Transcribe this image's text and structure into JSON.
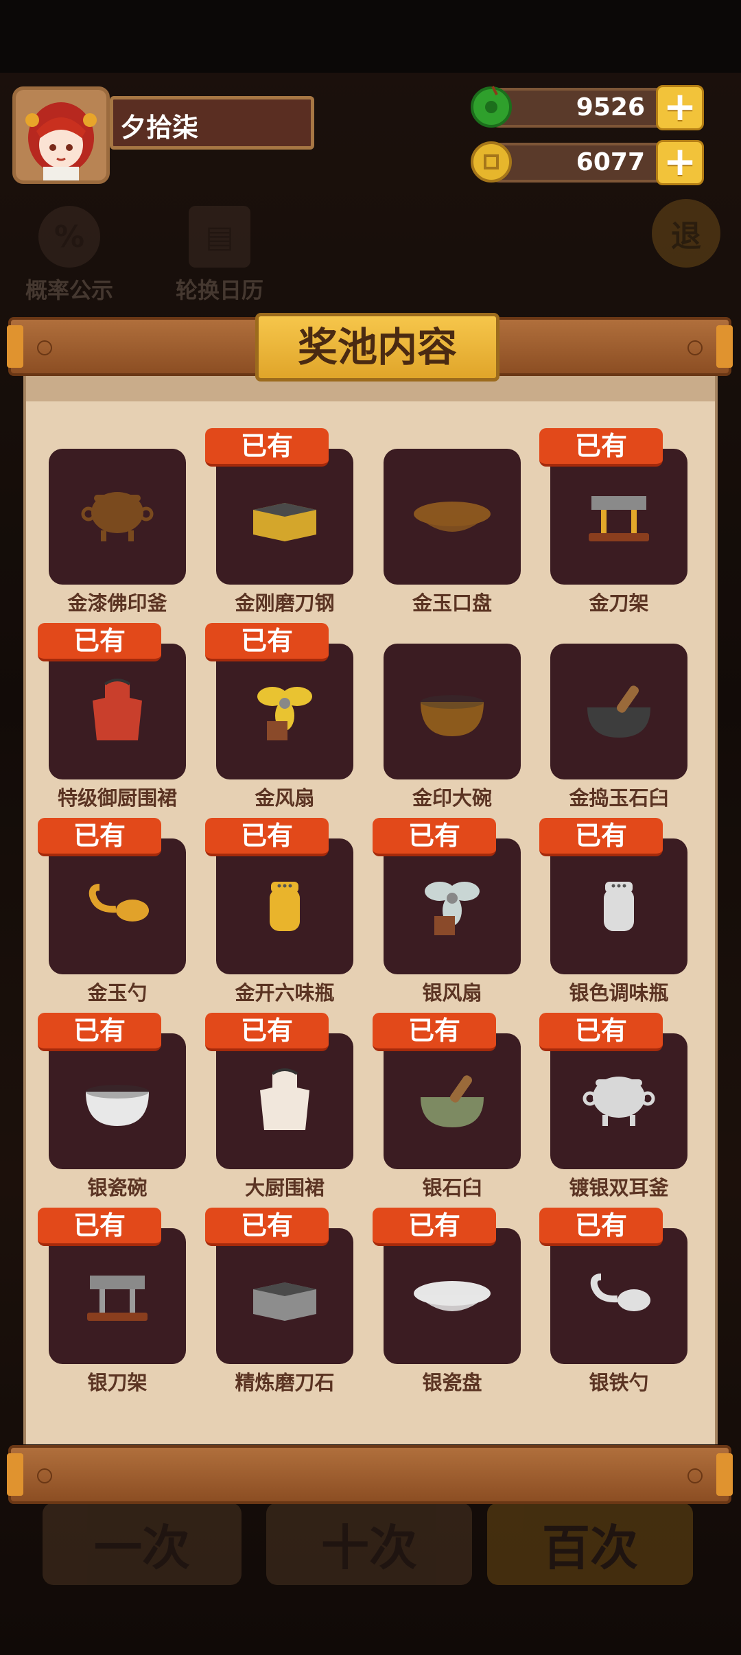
{
  "player": {
    "name": "夕拾柒"
  },
  "currency": [
    {
      "icon": "jade-coin-icon",
      "value": "9526",
      "color": "#2fa02c"
    },
    {
      "icon": "gold-coin-icon",
      "value": "6077",
      "color": "#e6b62c"
    }
  ],
  "background": {
    "probability_label": "概率公示",
    "calendar_label": "轮换日历",
    "exit_label": "退",
    "draw_buttons": [
      "一次",
      "十次",
      "百次"
    ]
  },
  "panel": {
    "title": "奖池内容",
    "owned_label": "已有",
    "items": [
      {
        "name": "金漆佛印釜",
        "owned": false,
        "icon": "cauldron-icon",
        "color": "#7a4a1e"
      },
      {
        "name": "金刚磨刀钢",
        "owned": true,
        "icon": "whetstone-icon",
        "color": "#d4a62b"
      },
      {
        "name": "金玉口盘",
        "owned": false,
        "icon": "plate-icon",
        "color": "#8a561f"
      },
      {
        "name": "金刀架",
        "owned": true,
        "icon": "knife-rack-icon",
        "color": "#e3a82a"
      },
      {
        "name": "特级御厨围裙",
        "owned": true,
        "icon": "apron-icon",
        "color": "#c93f2c"
      },
      {
        "name": "金风扇",
        "owned": true,
        "icon": "fan-icon",
        "color": "#e9c331"
      },
      {
        "name": "金印大碗",
        "owned": false,
        "icon": "bowl-icon",
        "color": "#8c5a1c"
      },
      {
        "name": "金捣玉石臼",
        "owned": false,
        "icon": "mortar-icon",
        "color": "#3d3d3d"
      },
      {
        "name": "金玉勺",
        "owned": true,
        "icon": "spoon-icon",
        "color": "#e1a22a"
      },
      {
        "name": "金开六味瓶",
        "owned": true,
        "icon": "shaker-icon",
        "color": "#e9b42c"
      },
      {
        "name": "银风扇",
        "owned": true,
        "icon": "fan-icon",
        "color": "#c9d6d4"
      },
      {
        "name": "银色调味瓶",
        "owned": true,
        "icon": "shaker-icon",
        "color": "#dcdcdc"
      },
      {
        "name": "银瓷碗",
        "owned": true,
        "icon": "bowl-icon",
        "color": "#e8e8e8"
      },
      {
        "name": "大厨围裙",
        "owned": true,
        "icon": "apron-icon",
        "color": "#f1e7dc"
      },
      {
        "name": "银石臼",
        "owned": true,
        "icon": "mortar-icon",
        "color": "#7d8a62"
      },
      {
        "name": "镀银双耳釜",
        "owned": true,
        "icon": "cauldron-icon",
        "color": "#d8d8d8"
      },
      {
        "name": "银刀架",
        "owned": true,
        "icon": "knife-rack-icon",
        "color": "#9b9b9b"
      },
      {
        "name": "精炼磨刀石",
        "owned": true,
        "icon": "whetstone-icon",
        "color": "#8d8d8d"
      },
      {
        "name": "银瓷盘",
        "owned": true,
        "icon": "plate-icon",
        "color": "#e6e6e6"
      },
      {
        "name": "银铁勺",
        "owned": true,
        "icon": "spoon-icon",
        "color": "#e0e0e0"
      }
    ]
  }
}
